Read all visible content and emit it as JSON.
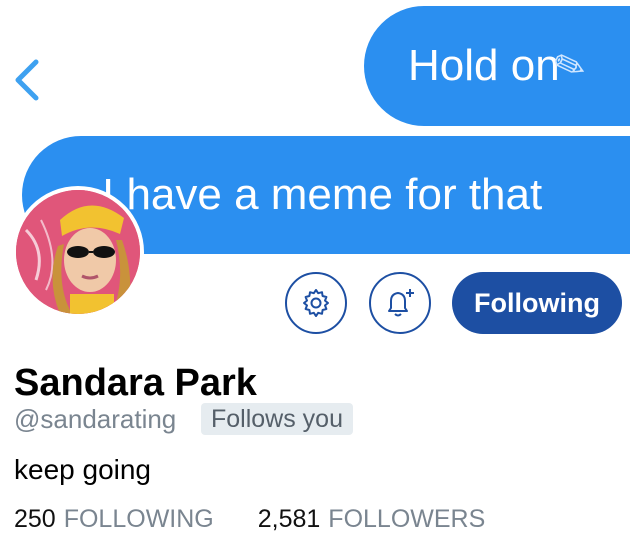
{
  "banner": {
    "bubble_top_text": "Hold on",
    "bubble_bottom_text": "I have a meme for that",
    "bubble_color": "#2b8ff0"
  },
  "nav": {
    "back_icon": "chevron-left-icon",
    "accent": "#3ea1f0"
  },
  "actions": {
    "settings_icon": "gear-icon",
    "notify_icon": "bell-plus-icon",
    "following_label": "Following",
    "primary_color": "#1d4fa3"
  },
  "profile": {
    "display_name": "Sandara Park",
    "handle": "@sandarating",
    "follows_you": "Follows you",
    "bio": "keep going"
  },
  "stats": {
    "following_count": "250",
    "following_label": "FOLLOWING",
    "followers_count": "2,581",
    "followers_label": "FOLLOWERS"
  }
}
